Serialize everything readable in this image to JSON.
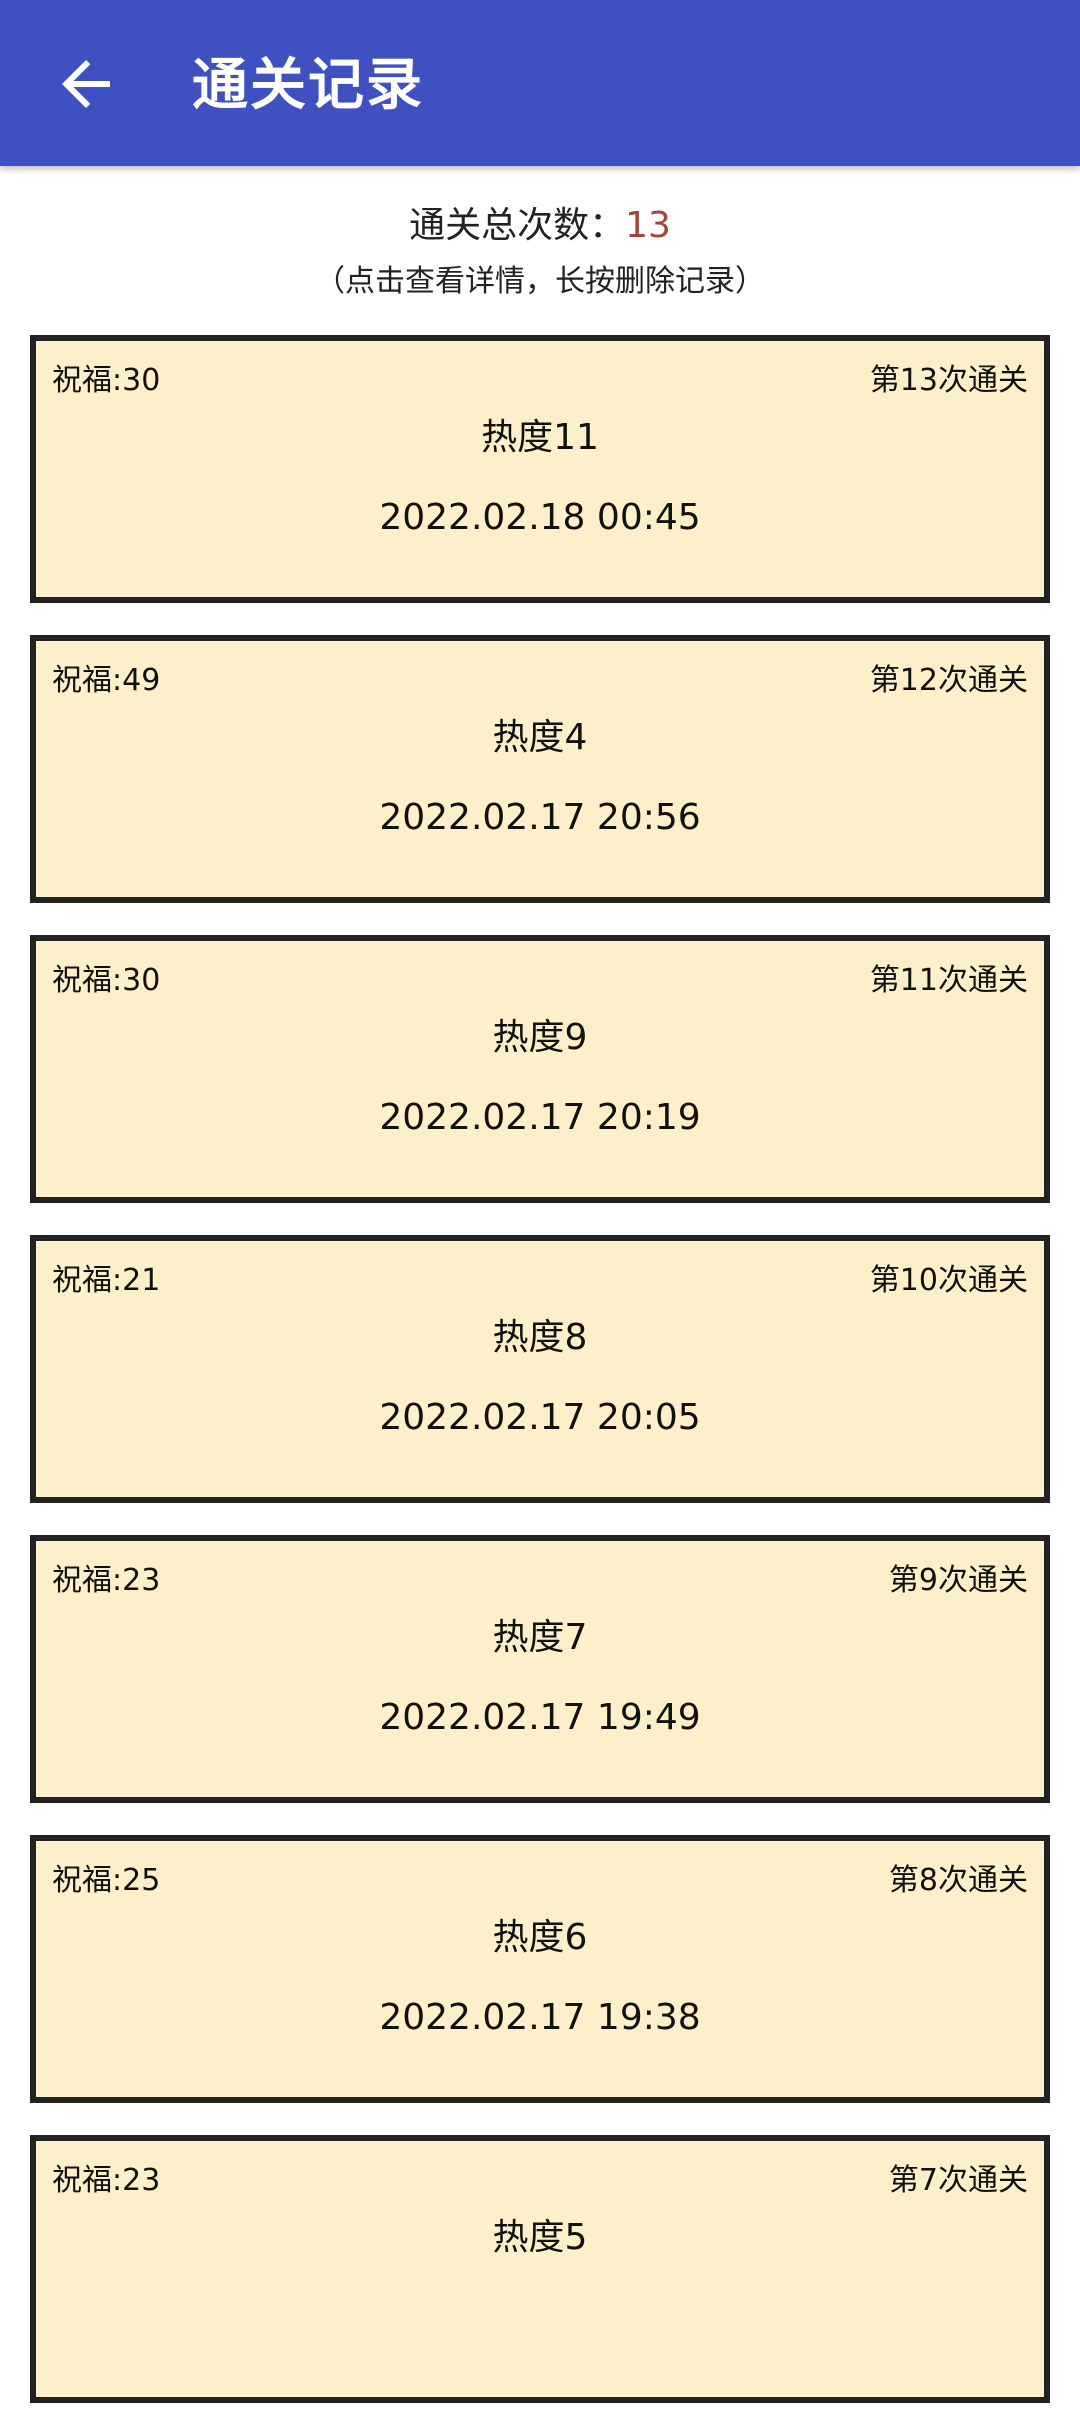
{
  "header": {
    "title": "通关记录",
    "back_icon": "arrow-left-icon"
  },
  "summary": {
    "label": "通关总次数：",
    "count": "13",
    "count_color": "#a0473a",
    "hint": "（点击查看详情，长按删除记录）"
  },
  "records": [
    {
      "bless": "祝福:30",
      "nth": "第13次通关",
      "heat": "热度11",
      "time": "2022.02.18 00:45"
    },
    {
      "bless": "祝福:49",
      "nth": "第12次通关",
      "heat": "热度4",
      "time": "2022.02.17 20:56"
    },
    {
      "bless": "祝福:30",
      "nth": "第11次通关",
      "heat": "热度9",
      "time": "2022.02.17 20:19"
    },
    {
      "bless": "祝福:21",
      "nth": "第10次通关",
      "heat": "热度8",
      "time": "2022.02.17 20:05"
    },
    {
      "bless": "祝福:23",
      "nth": "第9次通关",
      "heat": "热度7",
      "time": "2022.02.17 19:49"
    },
    {
      "bless": "祝福:25",
      "nth": "第8次通关",
      "heat": "热度6",
      "time": "2022.02.17 19:38"
    },
    {
      "bless": "祝福:23",
      "nth": "第7次通关",
      "heat": "热度5",
      "time": ""
    }
  ],
  "colors": {
    "appbar": "#3f51c1",
    "card_bg": "#fdefca",
    "card_border": "#222222"
  }
}
